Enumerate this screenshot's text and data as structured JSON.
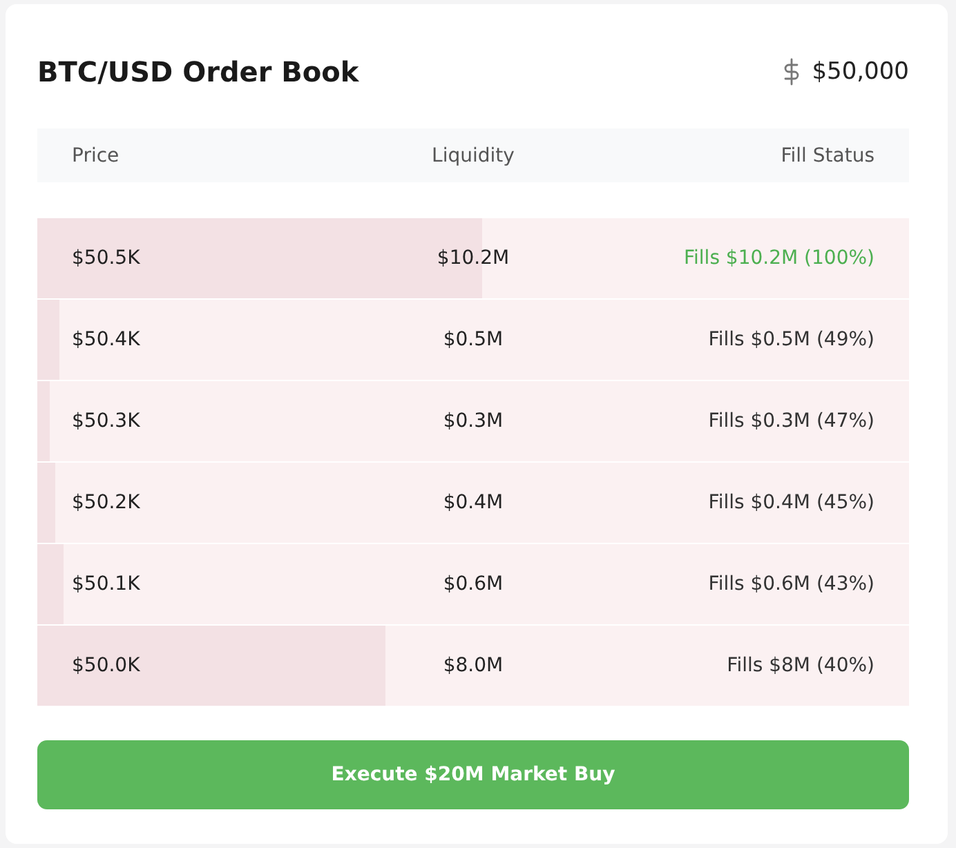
{
  "title": "BTC/USD Order Book",
  "price": "$50,000",
  "columns": [
    "Price",
    "Liquidity",
    "Fill Status"
  ],
  "rows": [
    {
      "price": "$50.5K",
      "liquidity": "$10.2M",
      "fill_status": "Fills $10.2M (100%)",
      "complete": true,
      "level": 0.51
    },
    {
      "price": "$50.4K",
      "liquidity": "$0.5M",
      "fill_status": "Fills $0.5M (49%)",
      "complete": false,
      "level": 0.025
    },
    {
      "price": "$50.3K",
      "liquidity": "$0.3M",
      "fill_status": "Fills $0.3M (47%)",
      "complete": false,
      "level": 0.015
    },
    {
      "price": "$50.2K",
      "liquidity": "$0.4M",
      "fill_status": "Fills $0.4M (45%)",
      "complete": false,
      "level": 0.02
    },
    {
      "price": "$50.1K",
      "liquidity": "$0.6M",
      "fill_status": "Fills $0.6M (43%)",
      "complete": false,
      "level": 0.03
    },
    {
      "price": "$50.0K",
      "liquidity": "$8.0M",
      "fill_status": "Fills $8M (40%)",
      "complete": false,
      "level": 0.4
    }
  ],
  "action_button": "Execute $20M Market Buy"
}
